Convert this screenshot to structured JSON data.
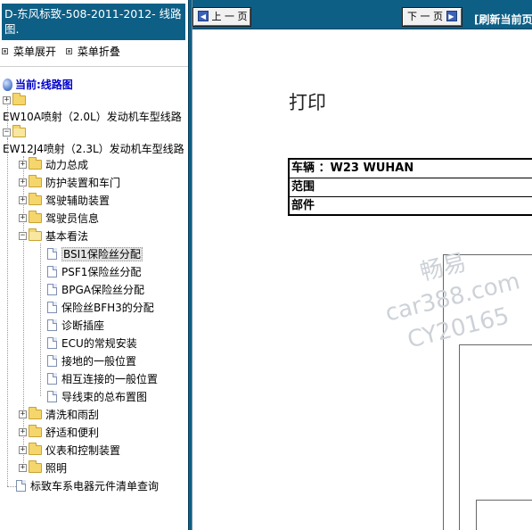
{
  "left": {
    "doc_title": "D-东风标致-508-2011-2012- 线路图.",
    "menu": {
      "expand": "菜单展开",
      "collapse": "菜单折叠"
    },
    "current": "当前:线路图",
    "tree": {
      "engine1": "EW10A喷射（2.0L）发动机车型线路",
      "engine2": "EW12J4喷射（2.3L）发动机车型线路",
      "folders": [
        "动力总成",
        "防护装置和车门",
        "驾驶辅助装置",
        "驾驶员信息",
        "基本看法"
      ],
      "pages": [
        "BSI1保险丝分配",
        "PSF1保险丝分配",
        "BPGA保险丝分配",
        "保险丝BFH3的分配",
        "诊断插座",
        "ECU的常规安装",
        "接地的一般位置",
        "相互连接的一般位置",
        "导线束的总布置图"
      ],
      "folders_after": [
        "清洗和雨刮",
        "舒适和便利",
        "仪表和控制装置",
        "照明"
      ],
      "bottom_page": "标致车系电器元件清单查询"
    }
  },
  "toolbar": {
    "prev": "上 一 页",
    "next": "下 一 页",
    "refresh": "[刷新当前页"
  },
  "content": {
    "print_title": "打印",
    "vehicle": "车辆 ：W23 WUHAN",
    "scope": "范围",
    "part": "部件",
    "watermark": [
      "畅易",
      "car388.com",
      "CY20165"
    ]
  },
  "colors": {
    "frame_blue": "#0e5f86",
    "current_blue": "#0000cc"
  }
}
